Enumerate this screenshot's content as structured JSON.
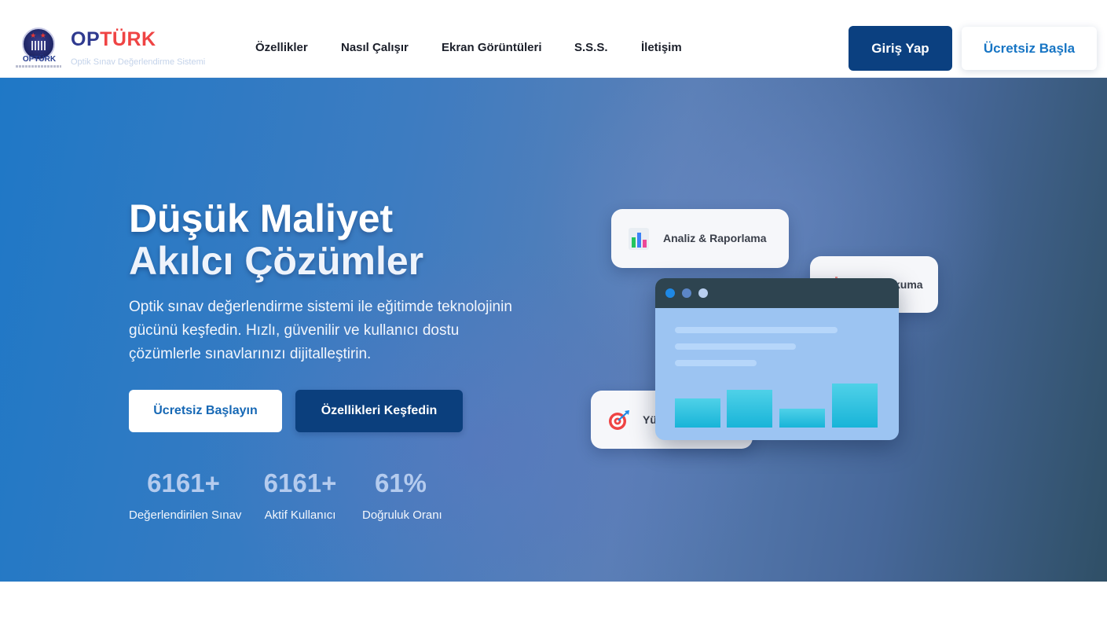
{
  "header": {
    "logo_mini": "OPTÜRK",
    "brand": {
      "part1": "OP",
      "part2": "TÜRK"
    },
    "subtitle": "Optik Sınav Değerlendirme Sistemi",
    "nav": [
      "Özellikler",
      "Nasıl Çalışır",
      "Ekran Görüntüleri",
      "S.S.S.",
      "İletişim"
    ],
    "login_label": "Giriş Yap",
    "start_label": "Ücretsiz Başla"
  },
  "hero": {
    "title_line1": "Düşük Maliyet",
    "title_line2": "Akılcı Çözümler",
    "lead": "Optik sınav değerlendirme sistemi ile eğitimde teknolojinin gücünü keşfedin. Hızlı, güvenilir ve kullanıcı dostu çözümlerle sınavlarınızı dijitalleştirin.",
    "cta_primary": "Ücretsiz Başlayın",
    "cta_secondary": "Özellikleri Keşfedin",
    "stats": [
      {
        "value": "6161+",
        "label": "Değerlendirilen Sınav"
      },
      {
        "value": "6161+",
        "label": "Aktif Kullanıcı"
      },
      {
        "value": "61%",
        "label": "Doğruluk Oranı"
      }
    ]
  },
  "cards": {
    "analysis": "Analiz & Raporlama",
    "reading_partial": "kuma",
    "high_partial": "Yü"
  },
  "icons": {
    "analysis": "bar-chart-icon",
    "target": "target-icon"
  },
  "mockup_bar_levels": [
    0.65,
    0.85,
    0.42,
    0.98
  ],
  "colors": {
    "brand_blue": "#2f3a8f",
    "brand_red": "#ef4444",
    "primary_dark": "#0b4080",
    "link_blue": "#1775c4"
  }
}
